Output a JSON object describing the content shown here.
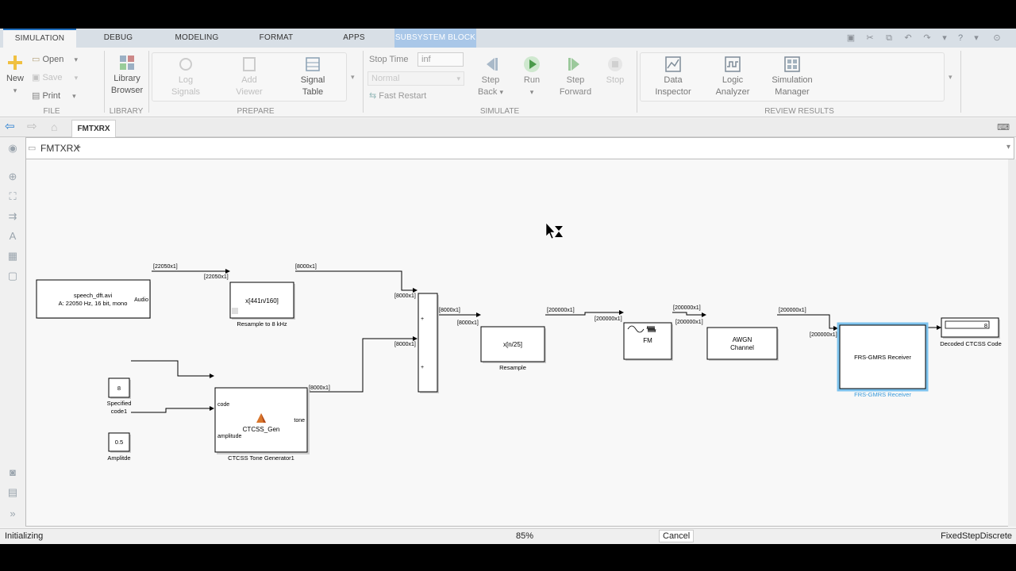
{
  "tabs": [
    "SIMULATION",
    "DEBUG",
    "MODELING",
    "FORMAT",
    "APPS",
    "SUBSYSTEM BLOCK"
  ],
  "ribbon": {
    "new": "New",
    "open": "Open",
    "save": "Save",
    "print": "Print",
    "library_browser": [
      "Library",
      "Browser"
    ],
    "log_signals": [
      "Log",
      "Signals"
    ],
    "add_viewer": [
      "Add",
      "Viewer"
    ],
    "signal_table": [
      "Signal",
      "Table"
    ],
    "stop_time_label": "Stop Time",
    "stop_time_value": "inf",
    "sim_mode": "Normal",
    "fast_restart": "Fast Restart",
    "step_back": [
      "Step",
      "Back"
    ],
    "run": "Run",
    "step_forward": [
      "Step",
      "Forward"
    ],
    "stop": "Stop",
    "data_inspector": [
      "Data",
      "Inspector"
    ],
    "logic_analyzer": [
      "Logic",
      "Analyzer"
    ],
    "simulation_manager": [
      "Simulation",
      "Manager"
    ],
    "groups": {
      "file": "FILE",
      "library": "LIBRARY",
      "prepare": "PREPARE",
      "simulate": "SIMULATE",
      "review": "REVIEW RESULTS"
    }
  },
  "model_tab": "FMTXRX",
  "breadcrumb": "FMTXRX",
  "blocks": {
    "audio_line1": "speech_dft.avi",
    "audio_line2": "A: 22050 Hz, 16 bit, mono",
    "audio_port": "Audio",
    "resample8_expr": "x[441n/160]",
    "resample8_label": "Resample to 8 kHz",
    "sum_plus": "+",
    "resample_expr": "x[n/25]",
    "resample_label": "Resample",
    "fm": "FM",
    "awgn_line1": "AWGN",
    "awgn_line2": "Channel",
    "frs": "FRS-GMRS Receiver",
    "frs_label": "FRS-GMRS Receiver",
    "display_value": "8",
    "display_label": "Decoded CTCSS Code",
    "const_code": "8",
    "const_code_label1": "Specified",
    "const_code_label2": "code1",
    "const_amp": "0.5",
    "const_amp_label": "Amplitde",
    "ctcss_port_code": "code",
    "ctcss_port_amp": "amplitude",
    "ctcss_port_tone": "tone",
    "ctcss_name": "CTCSS_Gen",
    "ctcss_label": "CTCSS Tone Generator1"
  },
  "signals": {
    "s22050": "[22050x1]",
    "s8000": "[8000x1]",
    "s200000": "[200000x1]"
  },
  "status": {
    "left": "Initializing",
    "zoom": "85%",
    "cancel": "Cancel",
    "solver": "FixedStepDiscrete"
  }
}
